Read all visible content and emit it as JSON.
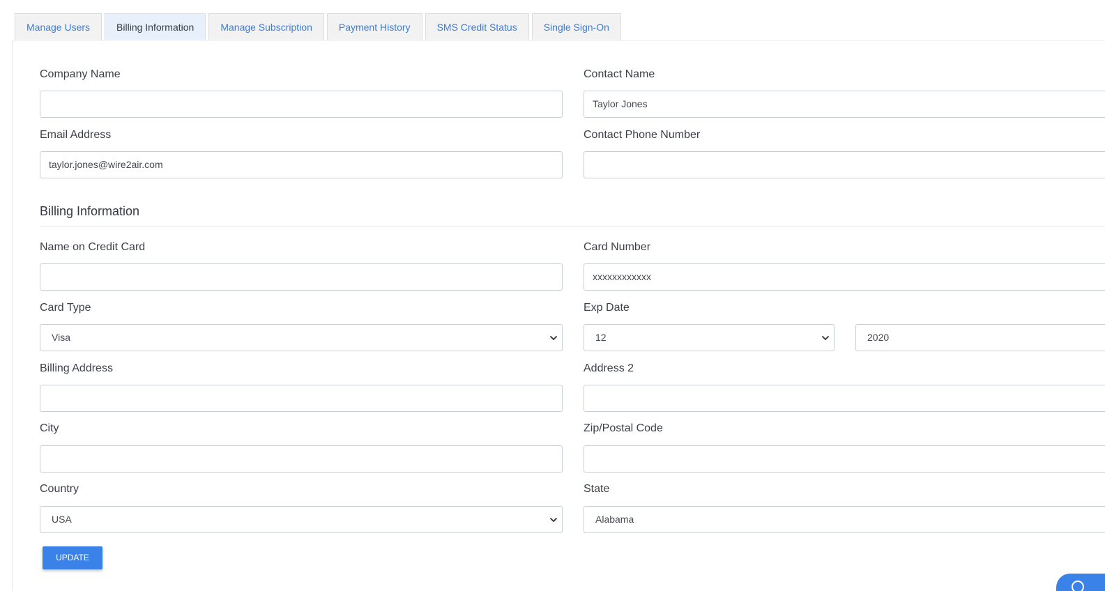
{
  "tabs": [
    {
      "label": "Manage Users",
      "active": false
    },
    {
      "label": "Billing Information",
      "active": true
    },
    {
      "label": "Manage Subscription",
      "active": false
    },
    {
      "label": "Payment History",
      "active": false
    },
    {
      "label": "SMS Credit Status",
      "active": false
    },
    {
      "label": "Single Sign-On",
      "active": false
    }
  ],
  "contact": {
    "company_name_label": "Company Name",
    "company_name_value": "",
    "contact_name_label": "Contact Name",
    "contact_name_value": "Taylor Jones",
    "email_label": "Email Address",
    "email_value": "taylor.jones@wire2air.com",
    "phone_label": "Contact Phone Number",
    "phone_value": ""
  },
  "billing": {
    "section_title": "Billing Information",
    "name_on_card_label": "Name on Credit Card",
    "name_on_card_value": "",
    "card_number_label": "Card Number",
    "card_number_value": "xxxxxxxxxxxx",
    "card_type_label": "Card Type",
    "card_type_value": "Visa",
    "exp_date_label": "Exp Date",
    "exp_month_value": "12",
    "exp_year_value": "2020",
    "billing_address_label": "Billing Address",
    "billing_address_value": "",
    "address2_label": "Address 2",
    "address2_value": "",
    "city_label": "City",
    "city_value": "",
    "zip_label": "Zip/Postal Code",
    "zip_value": "",
    "country_label": "Country",
    "country_value": "USA",
    "state_label": "State",
    "state_value": "Alabama"
  },
  "actions": {
    "update_label": "UPDATE"
  },
  "colors": {
    "accent": "#3b82e8",
    "tab_link": "#3b7ddd",
    "active_tab_bg": "#e8f0fc"
  },
  "icons": {
    "dropdown": "chevron-down-icon",
    "chat": "chat-bubble-icon"
  }
}
